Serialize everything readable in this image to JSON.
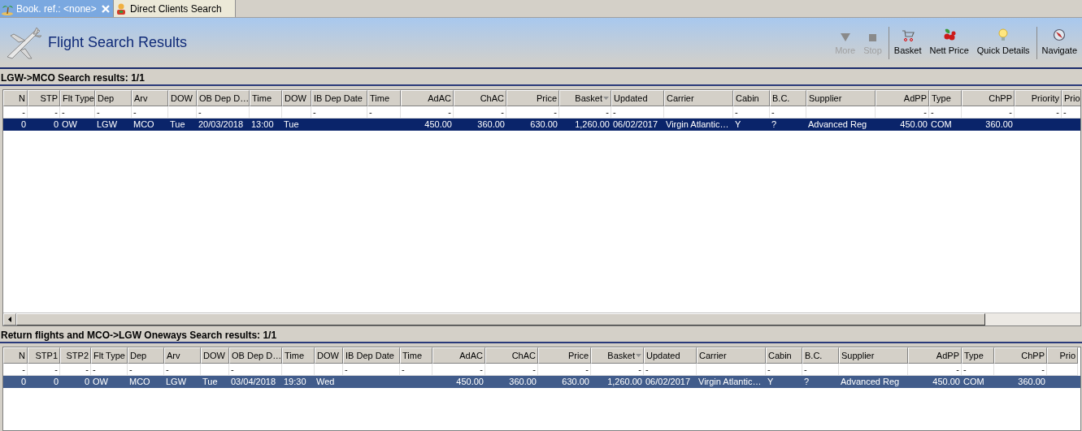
{
  "tabs": [
    {
      "label": "Book. ref.: <none>",
      "selected": true,
      "closable": true
    },
    {
      "label": "Direct Clients Search",
      "selected": false,
      "closable": false
    }
  ],
  "header": {
    "title": "Flight Search Results"
  },
  "toolbar": {
    "groups": [
      [
        {
          "label": "More",
          "kind": "more",
          "disabled": true
        },
        {
          "label": "Stop",
          "kind": "stop",
          "disabled": true
        }
      ],
      [
        {
          "label": "Basket",
          "kind": "basket",
          "disabled": false
        },
        {
          "label": "Nett Price",
          "kind": "price",
          "disabled": false
        },
        {
          "label": "Quick Details",
          "kind": "details",
          "disabled": false
        }
      ],
      [
        {
          "label": "Navigate",
          "kind": "navigate",
          "disabled": false
        }
      ]
    ]
  },
  "sections": [
    {
      "title": "LGW->MCO Search results: 1/1",
      "focused": true,
      "scrollbar": true,
      "columns": [
        {
          "label": "N",
          "kind": "number",
          "sorted": false
        },
        {
          "label": "STP",
          "kind": "number",
          "sorted": false
        },
        {
          "label": "Flt Type",
          "kind": "text",
          "sorted": false
        },
        {
          "label": "Dep",
          "kind": "text",
          "sorted": false
        },
        {
          "label": "Arv",
          "kind": "text",
          "sorted": false
        },
        {
          "label": "DOW",
          "kind": "text",
          "sorted": false
        },
        {
          "label": "OB Dep D…",
          "kind": "text",
          "sorted": false
        },
        {
          "label": "Time",
          "kind": "text",
          "sorted": false
        },
        {
          "label": "DOW",
          "kind": "text",
          "sorted": false
        },
        {
          "label": "IB Dep Date",
          "kind": "text",
          "sorted": false
        },
        {
          "label": "Time",
          "kind": "text",
          "sorted": false
        },
        {
          "label": "AdAC",
          "kind": "number",
          "sorted": false
        },
        {
          "label": "ChAC",
          "kind": "number",
          "sorted": false
        },
        {
          "label": "Price",
          "kind": "number",
          "sorted": false
        },
        {
          "label": "Basket",
          "kind": "number",
          "sorted": true
        },
        {
          "label": "Updated",
          "kind": "text",
          "sorted": false
        },
        {
          "label": "Carrier",
          "kind": "text",
          "sorted": false
        },
        {
          "label": "Cabin",
          "kind": "text",
          "sorted": false
        },
        {
          "label": "B.C.",
          "kind": "text",
          "sorted": false
        },
        {
          "label": "Supplier",
          "kind": "text",
          "sorted": false
        },
        {
          "label": "AdPP",
          "kind": "number",
          "sorted": false
        },
        {
          "label": "Type",
          "kind": "text",
          "sorted": false
        },
        {
          "label": "ChPP",
          "kind": "number",
          "sorted": false
        },
        {
          "label": "Priority",
          "kind": "number",
          "sorted": false
        },
        {
          "label": "Prio",
          "kind": "text",
          "sorted": false
        }
      ],
      "filter": [
        {
          "kind": "dash",
          "value": "-"
        },
        {
          "kind": "dash",
          "value": "-"
        },
        {
          "kind": "dash",
          "value": "-"
        },
        {
          "kind": "dash",
          "value": "-"
        },
        {
          "kind": "dash",
          "value": "-"
        },
        {
          "kind": "blank"
        },
        {
          "kind": "dash",
          "value": "-"
        },
        {
          "kind": "blank"
        },
        {
          "kind": "blank"
        },
        {
          "kind": "dash",
          "value": "-"
        },
        {
          "kind": "dash",
          "value": "-"
        },
        {
          "kind": "dash",
          "value": "-"
        },
        {
          "kind": "dash",
          "value": "-"
        },
        {
          "kind": "dash",
          "value": "-"
        },
        {
          "kind": "dash",
          "value": "-"
        },
        {
          "kind": "dash",
          "value": "-"
        },
        {
          "kind": "blank"
        },
        {
          "kind": "dash",
          "value": "-"
        },
        {
          "kind": "dash",
          "value": "-"
        },
        {
          "kind": "blank"
        },
        {
          "kind": "dash",
          "value": "-"
        },
        {
          "kind": "dash",
          "value": "-"
        },
        {
          "kind": "dash",
          "value": "-"
        },
        {
          "kind": "dash",
          "value": "-"
        },
        {
          "kind": "dash",
          "value": "-"
        }
      ],
      "rows": [
        {
          "selected": true,
          "cells": [
            "0",
            "0",
            "OW",
            "LGW",
            "MCO",
            "Tue",
            "20/03/2018",
            "13:00",
            "Tue",
            null,
            null,
            "450.00",
            "360.00",
            "630.00",
            "1,260.00",
            "06/02/2017",
            "Virgin Atlantic…",
            "Y",
            "?",
            "Advanced Reg",
            "450.00",
            "COM",
            "360.00",
            null,
            null
          ]
        }
      ]
    },
    {
      "title": "Return flights and MCO->LGW Oneways Search results: 1/1",
      "focused": false,
      "scrollbar": false,
      "columns": [
        {
          "label": "N",
          "kind": "number",
          "sorted": false
        },
        {
          "label": "STP1",
          "kind": "number",
          "sorted": false
        },
        {
          "label": "STP2",
          "kind": "number",
          "sorted": false
        },
        {
          "label": "Flt Type",
          "kind": "text",
          "sorted": false
        },
        {
          "label": "Dep",
          "kind": "text",
          "sorted": false
        },
        {
          "label": "Arv",
          "kind": "text",
          "sorted": false
        },
        {
          "label": "DOW",
          "kind": "text",
          "sorted": false
        },
        {
          "label": "OB Dep D…",
          "kind": "text",
          "sorted": false
        },
        {
          "label": "Time",
          "kind": "text",
          "sorted": false
        },
        {
          "label": "DOW",
          "kind": "text",
          "sorted": false
        },
        {
          "label": "IB Dep Date",
          "kind": "text",
          "sorted": false
        },
        {
          "label": "Time",
          "kind": "text",
          "sorted": false
        },
        {
          "label": "AdAC",
          "kind": "number",
          "sorted": false
        },
        {
          "label": "ChAC",
          "kind": "number",
          "sorted": false
        },
        {
          "label": "Price",
          "kind": "number",
          "sorted": false
        },
        {
          "label": "Basket",
          "kind": "number",
          "sorted": true
        },
        {
          "label": "Updated",
          "kind": "text",
          "sorted": false
        },
        {
          "label": "Carrier",
          "kind": "text",
          "sorted": false
        },
        {
          "label": "Cabin",
          "kind": "text",
          "sorted": false
        },
        {
          "label": "B.C.",
          "kind": "text",
          "sorted": false
        },
        {
          "label": "Supplier",
          "kind": "text",
          "sorted": false
        },
        {
          "label": "AdPP",
          "kind": "number",
          "sorted": false
        },
        {
          "label": "Type",
          "kind": "text",
          "sorted": false
        },
        {
          "label": "ChPP",
          "kind": "number",
          "sorted": false
        },
        {
          "label": "Prio",
          "kind": "number",
          "sorted": false
        }
      ],
      "filter": [
        {
          "kind": "dash",
          "value": "-"
        },
        {
          "kind": "dash",
          "value": "-"
        },
        {
          "kind": "dash",
          "value": "-"
        },
        {
          "kind": "dash",
          "value": "-"
        },
        {
          "kind": "dash",
          "value": "-"
        },
        {
          "kind": "dash",
          "value": "-"
        },
        {
          "kind": "blank"
        },
        {
          "kind": "dash",
          "value": "-"
        },
        {
          "kind": "blank"
        },
        {
          "kind": "blank"
        },
        {
          "kind": "dash",
          "value": "-"
        },
        {
          "kind": "dash",
          "value": "-"
        },
        {
          "kind": "dash",
          "value": "-"
        },
        {
          "kind": "dash",
          "value": "-"
        },
        {
          "kind": "dash",
          "value": "-"
        },
        {
          "kind": "dash",
          "value": "-"
        },
        {
          "kind": "dash",
          "value": "-"
        },
        {
          "kind": "blank"
        },
        {
          "kind": "dash",
          "value": "-"
        },
        {
          "kind": "dash",
          "value": "-"
        },
        {
          "kind": "blank"
        },
        {
          "kind": "dash",
          "value": "-"
        },
        {
          "kind": "dash",
          "value": "-"
        },
        {
          "kind": "dash",
          "value": "-"
        },
        {
          "kind": "blank"
        }
      ],
      "rows": [
        {
          "selected": true,
          "cells": [
            "0",
            "0",
            "0",
            "OW",
            "MCO",
            "LGW",
            "Tue",
            "03/04/2018",
            "19:30",
            "Wed",
            null,
            null,
            "450.00",
            "360.00",
            "630.00",
            "1,260.00",
            "06/02/2017",
            "Virgin Atlantic…",
            "Y",
            "?",
            "Advanced Reg",
            "450.00",
            "COM",
            "360.00",
            null
          ]
        }
      ]
    }
  ]
}
